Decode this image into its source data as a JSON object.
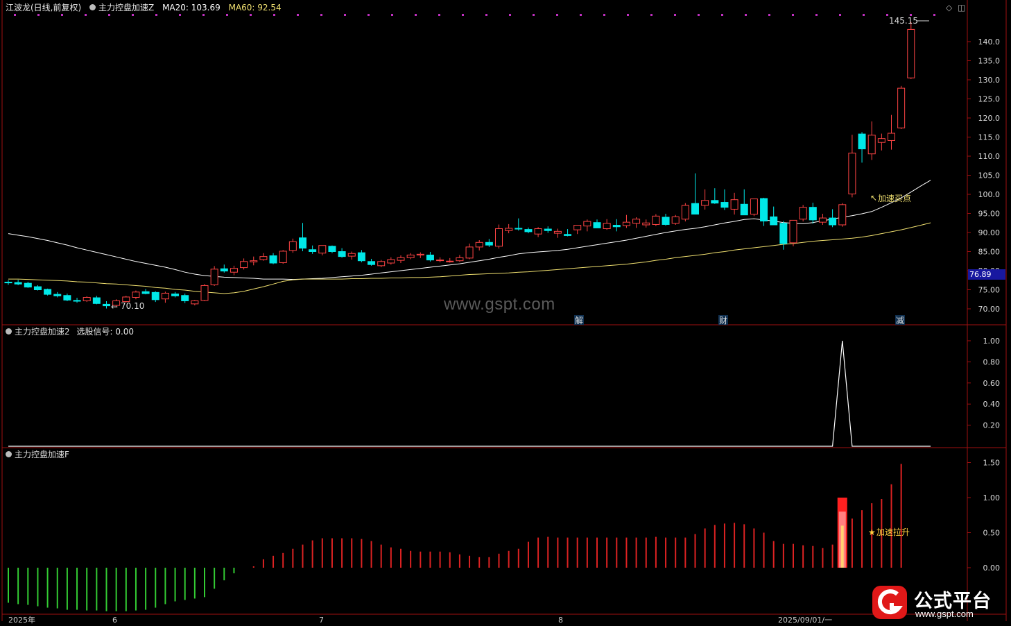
{
  "header": {
    "stock": "江波龙(日线,前复权)",
    "indicator": "主力控盘加速Z",
    "ma20": "MA20: 103.69",
    "ma60": "MA60: 92.54"
  },
  "panel2": {
    "title": "主力控盘加速2",
    "signal": "选股信号: 0.00"
  },
  "panel3": {
    "title": "主力控盘加速F"
  },
  "annotations": {
    "high": "145.15",
    "low": "70.10",
    "buy_point": "加速买点",
    "rise": "加速拉升",
    "event_jie": "解",
    "event_cai": "财",
    "event_jian": "减"
  },
  "current_price": "76.89",
  "x_axis": {
    "year": "2025年",
    "m6": "6",
    "m7": "7",
    "m8": "8",
    "cursor_date": "2025/09/01/一"
  },
  "watermark": "www.gspt.com",
  "logo": {
    "name": "公式平台",
    "url": "www.gspt.com"
  },
  "colors": {
    "up": "#ff4444",
    "down": "#00e8e8",
    "ma20": "#ffffff",
    "ma60": "#f0e070",
    "green_bar": "#33cc33",
    "red_bar": "#dd2222"
  },
  "chart_data": [
    {
      "type": "candlestick",
      "series_name": "江波龙",
      "ylim": [
        65.0,
        147.0
      ],
      "yticks": [
        "140.0",
        "135.0",
        "130.0",
        "125.0",
        "120.0",
        "115.0",
        "110.0",
        "105.0",
        "100.0",
        "95.00",
        "90.00",
        "85.00",
        "80.00",
        "75.00",
        "70.00"
      ],
      "ohlc": [
        [
          77.0,
          77.5,
          76.3,
          76.8
        ],
        [
          76.9,
          77.6,
          76.2,
          76.5
        ],
        [
          76.7,
          77.1,
          75.5,
          75.7
        ],
        [
          75.8,
          76.2,
          74.8,
          75.0
        ],
        [
          75.1,
          75.3,
          73.5,
          73.8
        ],
        [
          73.8,
          74.4,
          73.0,
          73.4
        ],
        [
          73.5,
          74.0,
          72.0,
          72.3
        ],
        [
          72.2,
          72.9,
          71.6,
          72.0
        ],
        [
          72.1,
          73.3,
          71.8,
          73.0
        ],
        [
          72.9,
          73.4,
          71.2,
          71.4
        ],
        [
          71.2,
          72.0,
          70.1,
          70.8
        ],
        [
          70.9,
          72.5,
          70.4,
          72.1
        ],
        [
          71.9,
          73.4,
          71.6,
          73.1
        ],
        [
          73.0,
          74.8,
          72.5,
          74.4
        ],
        [
          74.5,
          75.2,
          73.8,
          74.0
        ],
        [
          74.3,
          74.6,
          71.8,
          72.4
        ],
        [
          72.6,
          74.5,
          71.6,
          74.1
        ],
        [
          73.9,
          74.4,
          73.0,
          73.4
        ],
        [
          73.5,
          74.0,
          71.5,
          72.1
        ],
        [
          71.3,
          72.3,
          70.9,
          72.1
        ],
        [
          72.2,
          76.5,
          72.0,
          76.1
        ],
        [
          76.3,
          81.2,
          76.0,
          80.4
        ],
        [
          80.5,
          81.6,
          79.5,
          79.9
        ],
        [
          79.6,
          81.3,
          78.8,
          80.6
        ],
        [
          80.8,
          83.2,
          80.3,
          82.4
        ],
        [
          82.3,
          83.7,
          81.4,
          82.6
        ],
        [
          82.9,
          84.6,
          82.6,
          83.7
        ],
        [
          83.9,
          84.6,
          81.7,
          82.0
        ],
        [
          82.1,
          85.4,
          81.8,
          85.1
        ],
        [
          85.3,
          88.4,
          84.7,
          87.6
        ],
        [
          88.6,
          92.5,
          85.1,
          85.9
        ],
        [
          85.5,
          86.6,
          84.4,
          85.0
        ],
        [
          84.6,
          85.8,
          84.0,
          86.6
        ],
        [
          86.4,
          86.6,
          84.6,
          85.0
        ],
        [
          85.0,
          85.9,
          83.4,
          83.7
        ],
        [
          83.8,
          85.0,
          82.9,
          84.5
        ],
        [
          84.7,
          85.4,
          82.2,
          82.6
        ],
        [
          82.4,
          83.1,
          81.3,
          81.6
        ],
        [
          81.3,
          82.8,
          80.9,
          82.4
        ],
        [
          82.0,
          83.5,
          81.6,
          82.9
        ],
        [
          82.7,
          84.0,
          82.0,
          83.4
        ],
        [
          83.4,
          84.6,
          83.0,
          84.1
        ],
        [
          84.1,
          84.8,
          83.3,
          84.3
        ],
        [
          84.1,
          84.9,
          82.4,
          82.8
        ],
        [
          82.8,
          83.5,
          82.2,
          82.8
        ],
        [
          82.5,
          83.3,
          82.1,
          82.5
        ],
        [
          82.6,
          84.1,
          82.3,
          83.4
        ],
        [
          83.3,
          87.1,
          83.0,
          86.2
        ],
        [
          86.2,
          88.0,
          85.3,
          87.4
        ],
        [
          87.4,
          88.3,
          86.2,
          86.7
        ],
        [
          86.4,
          92.1,
          85.8,
          91.0
        ],
        [
          90.5,
          92.2,
          89.8,
          91.1
        ],
        [
          91.1,
          93.7,
          90.5,
          90.9
        ],
        [
          90.8,
          91.3,
          89.8,
          90.2
        ],
        [
          89.6,
          91.4,
          88.8,
          91.0
        ],
        [
          90.9,
          91.6,
          89.9,
          90.5
        ],
        [
          89.8,
          91.0,
          88.6,
          90.3
        ],
        [
          89.5,
          90.9,
          89.0,
          89.2
        ],
        [
          90.7,
          91.6,
          89.6,
          91.9
        ],
        [
          91.7,
          93.4,
          90.3,
          92.9
        ],
        [
          92.6,
          93.4,
          91.4,
          91.2
        ],
        [
          91.0,
          93.5,
          90.7,
          92.4
        ],
        [
          91.9,
          93.5,
          90.3,
          91.5
        ],
        [
          91.8,
          94.6,
          91.2,
          92.7
        ],
        [
          92.4,
          94.0,
          91.2,
          93.5
        ],
        [
          92.0,
          93.4,
          91.3,
          92.5
        ],
        [
          92.1,
          94.8,
          91.7,
          94.3
        ],
        [
          94.0,
          94.9,
          91.8,
          92.1
        ],
        [
          92.4,
          94.6,
          92.0,
          94.1
        ],
        [
          93.5,
          97.7,
          92.9,
          97.1
        ],
        [
          97.6,
          105.5,
          96.1,
          94.8
        ],
        [
          97.1,
          101.3,
          96.0,
          98.4
        ],
        [
          98.4,
          101.6,
          97.5,
          97.7
        ],
        [
          97.9,
          101.3,
          95.9,
          96.6
        ],
        [
          96.1,
          100.4,
          94.7,
          98.6
        ],
        [
          97.4,
          101.3,
          96.0,
          94.6
        ],
        [
          94.8,
          97.1,
          94.3,
          98.8
        ],
        [
          98.9,
          99.1,
          91.7,
          93.0
        ],
        [
          94.1,
          96.8,
          92.1,
          92.0
        ],
        [
          92.4,
          93.0,
          85.5,
          87.1
        ],
        [
          87.3,
          93.1,
          86.4,
          93.2
        ],
        [
          93.5,
          97.2,
          92.9,
          96.6
        ],
        [
          96.6,
          97.8,
          92.3,
          93.3
        ],
        [
          92.7,
          94.9,
          92.0,
          93.8
        ],
        [
          93.8,
          96.1,
          91.4,
          92.0
        ],
        [
          92.0,
          97.7,
          91.5,
          97.3
        ],
        [
          100.1,
          115.6,
          99.2,
          110.8
        ],
        [
          115.8,
          116.3,
          108.3,
          111.9
        ],
        [
          110.6,
          119.1,
          109.0,
          115.5
        ],
        [
          113.6,
          115.9,
          111.5,
          114.6
        ],
        [
          114.1,
          120.8,
          111.7,
          116.0
        ],
        [
          117.4,
          128.4,
          117.1,
          127.8
        ],
        [
          130.5,
          145.15,
          130.2,
          143.2
        ]
      ],
      "ma20": [
        89.7,
        89.3,
        88.9,
        88.4,
        87.9,
        87.3,
        86.7,
        86.0,
        85.4,
        84.8,
        84.2,
        83.6,
        83.0,
        82.4,
        81.9,
        81.4,
        80.9,
        80.3,
        79.6,
        79.1,
        78.7,
        78.5,
        78.3,
        78.2,
        78.1,
        78.0,
        77.8,
        77.8,
        77.8,
        77.7,
        77.8,
        77.9,
        78.0,
        78.2,
        78.4,
        78.6,
        78.8,
        79.1,
        79.4,
        79.7,
        80.0,
        80.3,
        80.6,
        80.9,
        81.2,
        81.5,
        81.8,
        82.2,
        82.6,
        83.0,
        83.5,
        83.9,
        84.4,
        84.7,
        84.9,
        85.1,
        85.3,
        85.6,
        86.0,
        86.4,
        86.8,
        87.2,
        87.6,
        88.0,
        88.5,
        89.0,
        89.5,
        90.0,
        90.4,
        90.8,
        91.1,
        91.5,
        92.0,
        92.5,
        92.9,
        93.4,
        93.6,
        93.3,
        93.0,
        92.6,
        92.4,
        92.3,
        92.6,
        93.1,
        93.5,
        94.0,
        94.4,
        94.9,
        95.5,
        96.6,
        97.8,
        99.1,
        100.6,
        102.2,
        103.69
      ],
      "ma60": [
        77.8,
        77.8,
        77.7,
        77.6,
        77.5,
        77.4,
        77.3,
        77.1,
        77.0,
        76.8,
        76.6,
        76.5,
        76.3,
        76.1,
        75.9,
        75.6,
        75.4,
        75.1,
        74.9,
        74.6,
        74.4,
        74.2,
        74.0,
        74.2,
        74.6,
        75.2,
        75.8,
        76.5,
        77.2,
        77.6,
        77.8,
        77.8,
        77.8,
        77.8,
        77.8,
        77.9,
        77.9,
        78.0,
        78.0,
        78.1,
        78.1,
        78.2,
        78.2,
        78.3,
        78.4,
        78.6,
        78.8,
        79.0,
        79.1,
        79.2,
        79.3,
        79.4,
        79.6,
        79.7,
        79.9,
        80.1,
        80.3,
        80.5,
        80.7,
        80.9,
        81.1,
        81.3,
        81.5,
        81.7,
        82.0,
        82.3,
        82.7,
        83.0,
        83.4,
        83.7,
        84.0,
        84.3,
        84.7,
        85.0,
        85.4,
        85.7,
        86.0,
        86.3,
        86.6,
        86.9,
        87.1,
        87.4,
        87.7,
        87.9,
        88.1,
        88.3,
        88.5,
        88.8,
        89.2,
        89.7,
        90.2,
        90.7,
        91.3,
        91.9,
        92.54
      ]
    },
    {
      "type": "line",
      "series_name": "选股信号",
      "ylim": [
        0,
        1.0
      ],
      "yticks": [
        "1.00",
        "0.80",
        "0.60",
        "0.40",
        "0.20"
      ],
      "values": [
        0,
        0,
        0,
        0,
        0,
        0,
        0,
        0,
        0,
        0,
        0,
        0,
        0,
        0,
        0,
        0,
        0,
        0,
        0,
        0,
        0,
        0,
        0,
        0,
        0,
        0,
        0,
        0,
        0,
        0,
        0,
        0,
        0,
        0,
        0,
        0,
        0,
        0,
        0,
        0,
        0,
        0,
        0,
        0,
        0,
        0,
        0,
        0,
        0,
        0,
        0,
        0,
        0,
        0,
        0,
        0,
        0,
        0,
        0,
        0,
        0,
        0,
        0,
        0,
        0,
        0,
        0,
        0,
        0,
        0,
        0,
        0,
        0,
        0,
        0,
        0,
        0,
        0,
        0,
        0,
        0,
        0,
        0,
        0,
        0,
        1,
        0,
        0,
        0,
        0,
        0,
        0,
        0,
        0,
        0
      ]
    },
    {
      "type": "bar",
      "series_name": "主力控盘加速F",
      "ylim": [
        -0.6,
        1.6
      ],
      "yticks": [
        "1.50",
        "1.00",
        "0.50",
        "0.00"
      ],
      "values": [
        -0.5,
        -0.52,
        -0.53,
        -0.55,
        -0.57,
        -0.58,
        -0.6,
        -0.6,
        -0.61,
        -0.61,
        -0.62,
        -0.62,
        -0.62,
        -0.61,
        -0.6,
        -0.57,
        -0.52,
        -0.48,
        -0.46,
        -0.44,
        -0.42,
        -0.3,
        -0.18,
        -0.08,
        0.0,
        0.02,
        0.12,
        0.17,
        0.21,
        0.27,
        0.33,
        0.39,
        0.42,
        0.42,
        0.42,
        0.42,
        0.41,
        0.38,
        0.33,
        0.29,
        0.27,
        0.24,
        0.23,
        0.23,
        0.23,
        0.22,
        0.19,
        0.17,
        0.15,
        0.15,
        0.2,
        0.24,
        0.27,
        0.37,
        0.43,
        0.44,
        0.43,
        0.43,
        0.43,
        0.43,
        0.43,
        0.43,
        0.43,
        0.43,
        0.43,
        0.43,
        0.44,
        0.43,
        0.43,
        0.43,
        0.48,
        0.56,
        0.61,
        0.63,
        0.64,
        0.62,
        0.56,
        0.5,
        0.38,
        0.34,
        0.34,
        0.32,
        0.31,
        0.28,
        0.33,
        0.99,
        0.7,
        0.82,
        0.92,
        0.98,
        1.19,
        1.48
      ],
      "highlight_bar": {
        "value": 1.0,
        "colors": [
          "#ff2020",
          "#ff8080",
          "#ffd070"
        ]
      }
    }
  ]
}
